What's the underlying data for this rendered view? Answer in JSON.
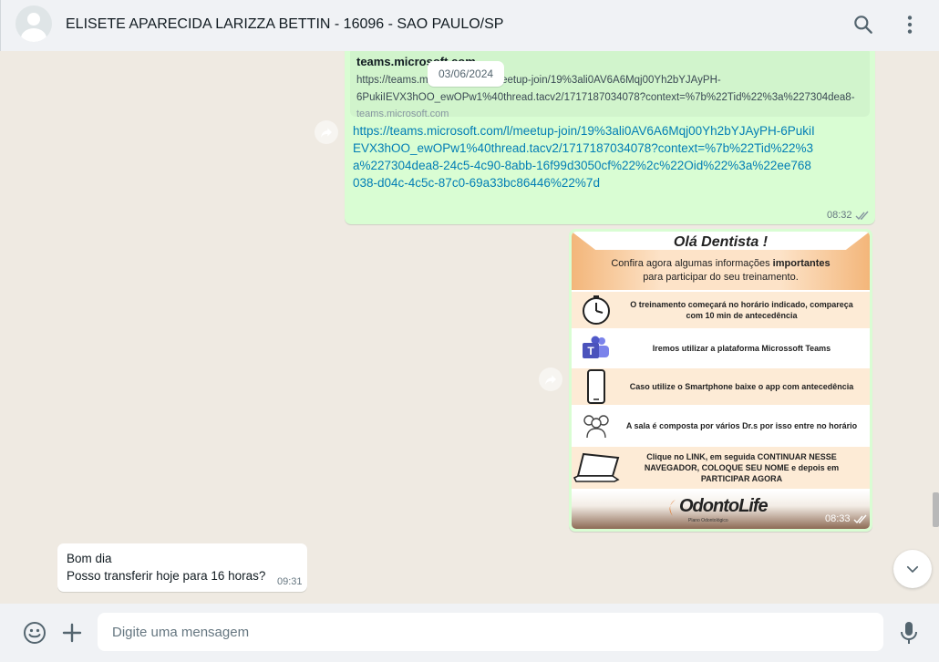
{
  "header": {
    "contact_name": "ELISETE APARECIDA LARIZZA BETTIN - 16096 - SAO PAULO/SP",
    "search_icon": "search-icon",
    "menu_icon": "kebab-menu-icon"
  },
  "chat": {
    "date_chip": "03/06/2024",
    "link_message": {
      "preview_title": "teams.microsoft.com",
      "preview_url_line1": "https://teams.microsoft.com/l/meetup-join/19%3ali0AV6A6Mqj00Yh2bYJAyPH-",
      "preview_url_line2": "6PukiIEVX3hOO_ewOPw1%40thread.tacv2/1717187034078?context=%7b%22Tid%22%3a%227304dea8-",
      "preview_domain": "teams.microsoft.com",
      "text": "https://teams.microsoft.com/l/meetup-join/19%3ali0AV6A6Mqj00Yh2bYJAyPH-6PukiIEVX3hOO_ewOPw1%40thread.tacv2/1717187034078?context=%7b%22Tid%22%3a%227304dea8-24c5-4c90-8abb-16f99d3050cf%22%2c%22Oid%22%3a%22ee768038-d04c-4c5c-87c0-69a33bc86446%22%7d",
      "time": "08:32"
    },
    "image_message": {
      "title": "Olá Dentista !",
      "subtitle_pre": "Confira agora algumas informações ",
      "subtitle_bold": "importantes",
      "subtitle_post": "para participar do seu treinamento.",
      "rows": [
        {
          "icon": "clock-icon",
          "text": "O treinamento começará no horário indicado, compareça com 10 min de antecedência"
        },
        {
          "icon": "teams-icon",
          "text": "Iremos utilizar a plataforma Microssoft Teams"
        },
        {
          "icon": "smartphone-icon",
          "text": "Caso utilize o Smartphone baixe o app com antecedência"
        },
        {
          "icon": "people-icon",
          "text": "A sala é composta por vários Dr.s por isso entre no horário"
        },
        {
          "icon": "laptop-icon",
          "text": "Clique no LINK, em seguida CONTINUAR NESSE NAVEGADOR, COLOQUE SEU NOME e depois em PARTICIPAR AGORA"
        }
      ],
      "logo_text": "OdontoLife",
      "logo_tagline": "Plano Odontológico",
      "time": "08:33"
    },
    "incoming_message": {
      "line1": "Bom dia",
      "line2": "Posso transferir hoje para 16 horas?",
      "time": "09:31"
    }
  },
  "composer": {
    "placeholder": "Digite uma mensagem",
    "value": ""
  },
  "colors": {
    "outgoing_bubble": "#d9fdd3",
    "incoming_bubble": "#ffffff",
    "link": "#027eb5",
    "chat_bg": "#efeae2",
    "header_bg": "#f0f2f5"
  }
}
